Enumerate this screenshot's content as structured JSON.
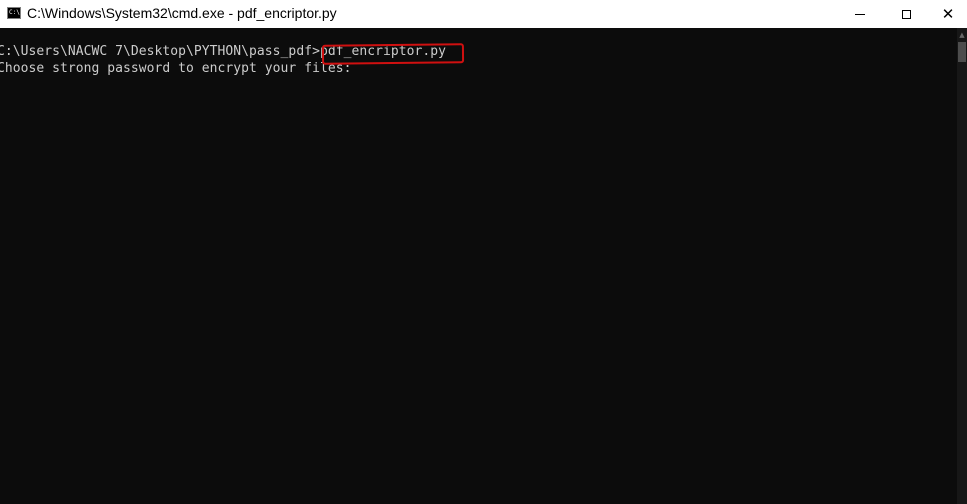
{
  "window": {
    "title": "C:\\Windows\\System32\\cmd.exe - pdf_encriptor.py",
    "icon_text": "C:\\",
    "controls": {
      "minimize_icon": "minimize-icon",
      "maximize_icon": "maximize-icon",
      "close_glyph": "✕"
    }
  },
  "console": {
    "lines": [
      "C:\\Users\\NACWC 7\\Desktop\\PYTHON\\pass_pdf>pdf_encriptor.py",
      "Choose strong password to encrypt your files:"
    ],
    "text_color": "#cccccc",
    "background": "#0c0c0c",
    "highlight_color": "#d01010"
  },
  "scrollbar": {
    "up_arrow": "▲"
  }
}
